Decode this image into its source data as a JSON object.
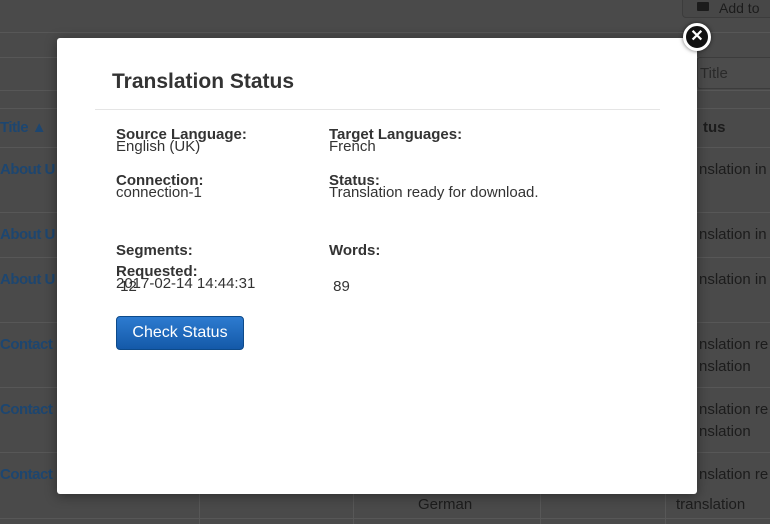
{
  "background": {
    "add_button_label": "Add to",
    "search_placeholder": "Title",
    "columns": {
      "title": "Title ▲",
      "status": "tus"
    },
    "rows": [
      {
        "title": "About U",
        "status": "nslation in",
        "status2": ""
      },
      {
        "title": "About U",
        "status": "nslation in",
        "status2": ""
      },
      {
        "title": "About U",
        "status": "nslation in",
        "status2": ""
      },
      {
        "title": "Contact",
        "status": "nslation re",
        "status2": "nslation"
      },
      {
        "title": "Contact",
        "status": "nslation re",
        "status2": "nslation"
      },
      {
        "title": "Contact",
        "status": "nslation re",
        "status2": "translation",
        "lang": "German"
      }
    ]
  },
  "modal": {
    "title": "Translation Status",
    "fields": {
      "source_language": {
        "label": "Source Language:",
        "value": "English (UK)"
      },
      "target_languages": {
        "label": "Target Languages:",
        "value": "French"
      },
      "connection": {
        "label": "Connection:",
        "value": "connection-1"
      },
      "status": {
        "label": "Status:",
        "value": "Translation ready for download."
      },
      "segments": {
        "label": "Segments:",
        "value": " 12"
      },
      "words": {
        "label": "Words:",
        "value": " 89"
      },
      "requested": {
        "label": "Requested:",
        "value": "2017-02-14 14:44:31"
      }
    },
    "check_status_label": "Check Status",
    "close_icon": "close-icon"
  },
  "colors": {
    "primary_button": "#1a63b5",
    "link": "#1f5f9e",
    "overlay": "#4a4a4a"
  }
}
